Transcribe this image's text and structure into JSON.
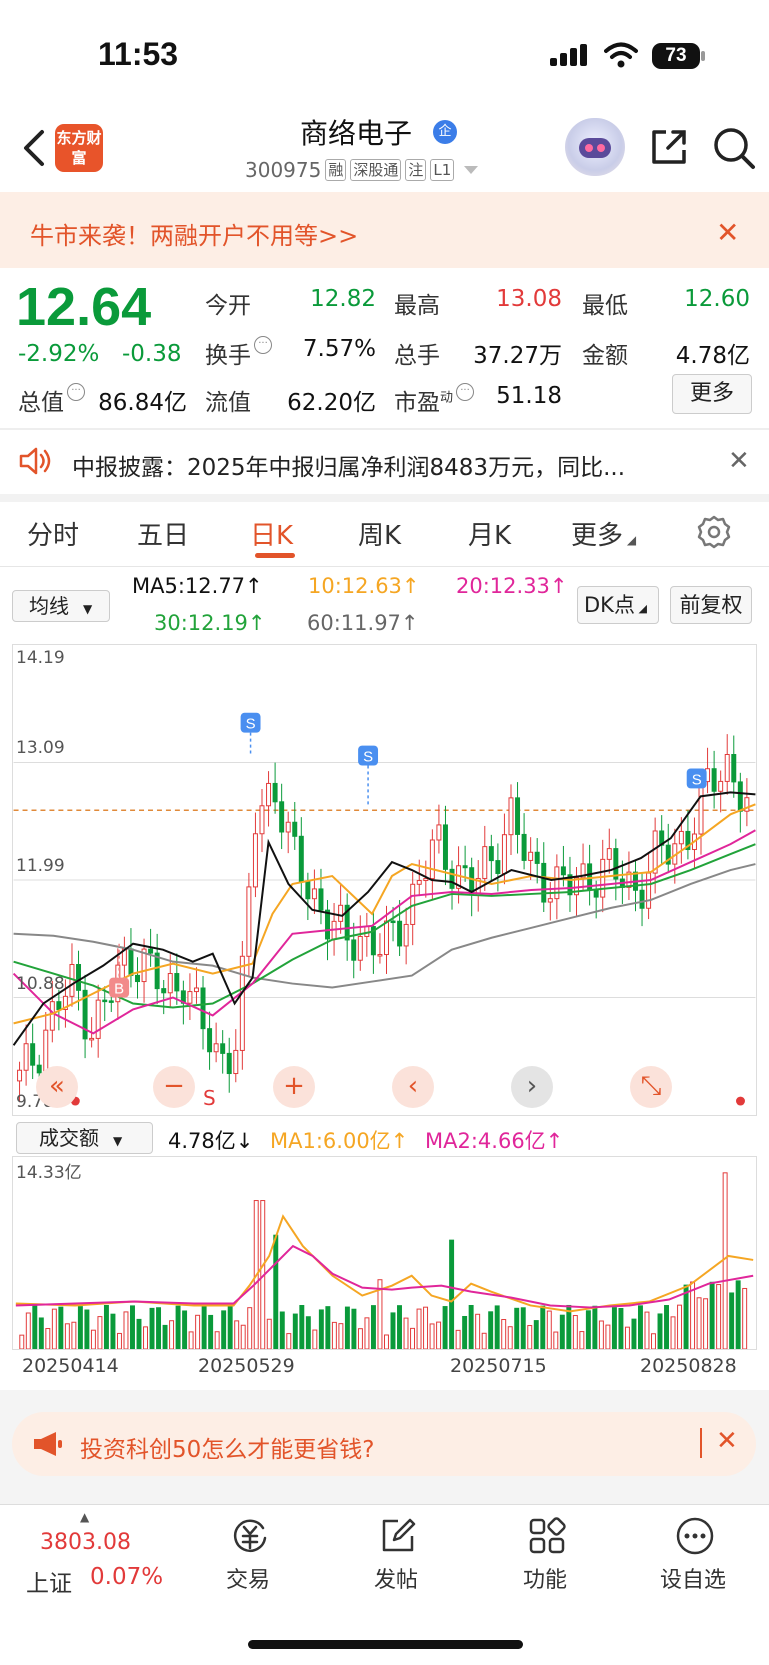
{
  "status_bar": {
    "time": "11:53",
    "battery": "73"
  },
  "nav": {
    "logo_text": "东方财富",
    "stock_name": "商络电子",
    "verified_badge": "企",
    "code": "300975",
    "tags": [
      "融",
      "深股通",
      "注",
      "L1"
    ]
  },
  "banner": {
    "text": "牛市来袭！两融开户不用等>>"
  },
  "quote": {
    "price": "12.64",
    "change_pct": "-2.92%",
    "change": "-0.38",
    "fields": {
      "open_label": "今开",
      "open": "12.82",
      "high_label": "最高",
      "high": "13.08",
      "low_label": "最低",
      "low": "12.60",
      "turnover_label": "换手",
      "turnover": "7.57%",
      "volume_label": "总手",
      "volume": "37.27万",
      "amount_label": "金额",
      "amount": "4.78亿",
      "mktcap_label": "总值",
      "mktcap": "86.84亿",
      "float_label": "流值",
      "float": "62.20亿",
      "pe_label": "市盈",
      "pe_sup": "动",
      "pe": "51.18"
    },
    "more_button": "更多"
  },
  "news": {
    "text": "中报披露：2025年中报归属净利润8483万元，同比..."
  },
  "tabs": [
    "分时",
    "五日",
    "日K",
    "周K",
    "月K",
    "更多"
  ],
  "ma_row": {
    "select": "均线",
    "ma5": "MA5:12.77↑",
    "ma10": "10:12.63↑",
    "ma20": "20:12.33↑",
    "ma30": "30:12.19↑",
    "ma60": "60:11.97↑",
    "dk_button": "DK点",
    "adjust_button": "前复权"
  },
  "colors": {
    "up": "#e23a3a",
    "down": "#0a9a3a",
    "ma5": "#000000",
    "ma10": "#f5a623",
    "ma20": "#e0269a",
    "ma30": "#22a33a",
    "ma60": "#888888",
    "accent": "#e2542a"
  },
  "kchart_axis": {
    "y_labels": [
      "14.19",
      "13.09",
      "11.99",
      "10.88",
      "9.78"
    ]
  },
  "markers": {
    "sell": "S",
    "buy": "B"
  },
  "chart_controls": [
    "«",
    "−",
    "+",
    "‹",
    "›",
    "⤡"
  ],
  "volume_row": {
    "select": "成交额",
    "value": "4.78亿↓",
    "ma1": "MA1:6.00亿↑",
    "ma2": "MA2:4.66亿↑",
    "y_max": "14.33亿"
  },
  "dates": [
    "20250414",
    "20250529",
    "20250715",
    "20250828"
  ],
  "promo": {
    "text": "投资科创50怎么才能更省钱?"
  },
  "bottom_bar": {
    "index_value": "3803.08",
    "index_name": "上证",
    "index_pct": "0.07%",
    "items": [
      "交易",
      "发帖",
      "功能",
      "设自选"
    ]
  },
  "chart_data": {
    "type": "candlestick",
    "y_range": [
      9.78,
      14.19
    ],
    "close_prices_approx": [
      10.1,
      10.4,
      10.8,
      11.0,
      10.6,
      10.9,
      11.3,
      11.2,
      10.9,
      11.1,
      10.6,
      10.3,
      10.5,
      12.6,
      12.9,
      12.2,
      11.9,
      11.6,
      11.4,
      11.5,
      11.3,
      11.6,
      12.0,
      12.3,
      12.1,
      11.9,
      12.2,
      12.6,
      12.1,
      12.0,
      11.9,
      12.0,
      12.1,
      12.0,
      11.9,
      12.2,
      12.3,
      12.5,
      12.9,
      13.1,
      12.64
    ],
    "volume_max": "14.33亿"
  }
}
